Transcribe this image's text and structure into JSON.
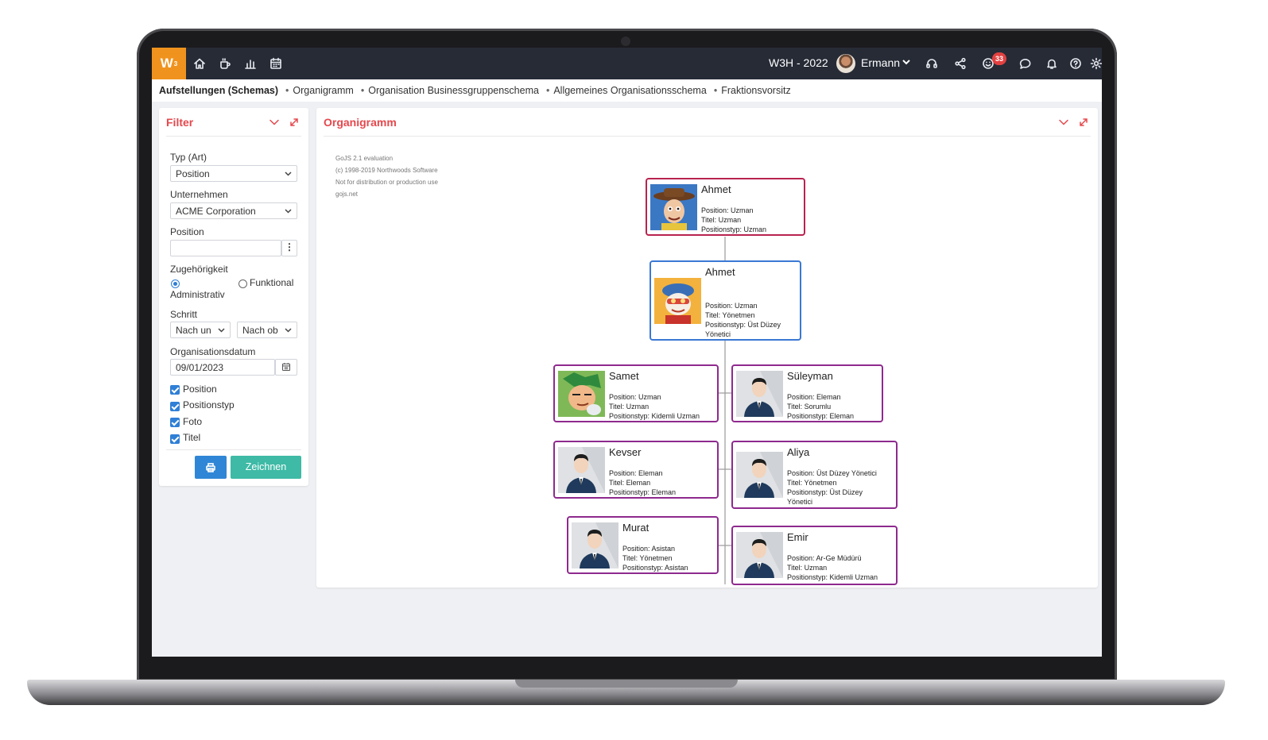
{
  "topbar": {
    "logo": "W",
    "logo_sup": "3",
    "icons": [
      "home-icon",
      "coffee-icon",
      "chart-icon",
      "calendar-icon"
    ],
    "year": "W3H - 2022",
    "user": "Ermann",
    "notification_count": "33",
    "right_icons": [
      "headset-icon",
      "share-icon",
      "smiley-icon",
      "chat-icon",
      "bell-icon",
      "help-icon",
      "gear-icon"
    ]
  },
  "breadcrumb": {
    "title": "Aufstellungen (Schemas)",
    "items": [
      "Organigramm",
      "Organisation Businessgruppenschema",
      "Allgemeines Organisationsschema",
      "Fraktionsvorsitz"
    ]
  },
  "filter": {
    "title": "Filter",
    "type_label": "Typ (Art)",
    "type_value": "Position",
    "company_label": "Unternehmen",
    "company_value": "ACME Corporation",
    "position_label": "Position",
    "position_value": "",
    "affiliation_label": "Zugehörigkeit",
    "affiliation_options": [
      "Administrativ",
      "Funktional"
    ],
    "step_label": "Schritt",
    "step_down": "Nach un",
    "step_up": "Nach ob",
    "date_label": "Organisationsdatum",
    "date_value": "09/01/2023",
    "checkboxes": [
      "Position",
      "Positionstyp",
      "Foto",
      "Titel"
    ],
    "draw_button": "Zeichnen"
  },
  "org": {
    "title": "Organigramm",
    "watermark": "GoJS 2.1 evaluation\n(c) 1998-2019 Northwoods Software\nNot for distribution or production use\ngojs.net",
    "nodes": [
      {
        "name": "Ahmet",
        "info": "Position: Uzman\nTitel: Uzman\nPositionstyp: Uzman"
      },
      {
        "name": "Ahmet",
        "info": "Position: Uzman\nTitel: Yönetmen\nPositionstyp: Üst Düzey\nYönetici"
      },
      {
        "name": "Samet",
        "info": "Position: Uzman\nTitel: Uzman\nPositionstyp: Kidemli Uzman"
      },
      {
        "name": "Süleyman",
        "info": "Position: Eleman\nTitel: Sorumlu\nPositionstyp: Eleman"
      },
      {
        "name": "Kevser",
        "info": "Position: Eleman\nTitel: Eleman\nPositionstyp: Eleman"
      },
      {
        "name": "Aliya",
        "info": "Position: Üst Düzey Yönetici\nTitel: Yönetmen\nPositionstyp: Üst Düzey\nYönetici"
      },
      {
        "name": "Murat",
        "info": "Position: Asistan\nTitel: Yönetmen\nPositionstyp: Asistan"
      },
      {
        "name": "Emir",
        "info": "Position: Ar-Ge Müdürü\nTitel: Uzman\nPositionstyp: Kidemli Uzman"
      }
    ]
  }
}
